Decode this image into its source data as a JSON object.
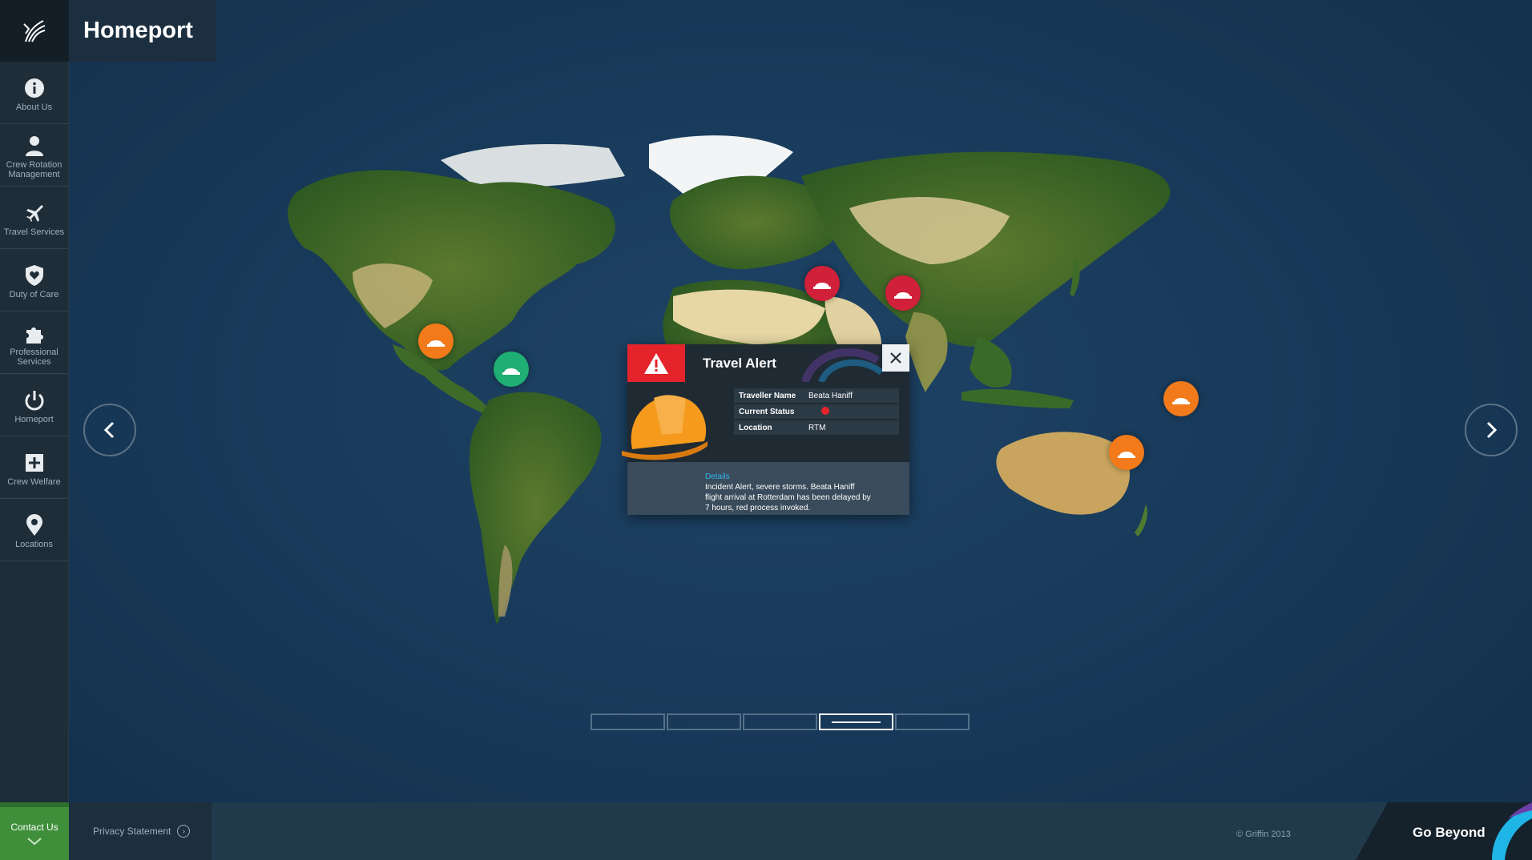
{
  "app": {
    "title": "Homeport"
  },
  "sidebar": {
    "items": [
      {
        "label": "About Us",
        "icon": "info-icon"
      },
      {
        "label": "Crew Rotation Management",
        "icon": "person-icon"
      },
      {
        "label": "Travel Services",
        "icon": "plane-icon"
      },
      {
        "label": "Duty of Care",
        "icon": "shield-heart-icon"
      },
      {
        "label": "Professional Services",
        "icon": "puzzle-icon"
      },
      {
        "label": "Homeport",
        "icon": "power-icon"
      },
      {
        "label": "Crew Welfare",
        "icon": "plus-icon"
      },
      {
        "label": "Locations",
        "icon": "pin-icon"
      }
    ],
    "contact_label": "Contact Us"
  },
  "markers": [
    {
      "region": "west-us",
      "status": "amber",
      "color": "#f27a1a"
    },
    {
      "region": "mexico",
      "status": "green",
      "color": "#1fae73"
    },
    {
      "region": "western-europe",
      "status": "red",
      "color": "#d0203a"
    },
    {
      "region": "eastern-europe",
      "status": "red",
      "color": "#d0203a"
    },
    {
      "region": "east-asia",
      "status": "amber",
      "color": "#f27a1a"
    },
    {
      "region": "southeast-asia",
      "status": "amber",
      "color": "#f27a1a"
    }
  ],
  "popup": {
    "title": "Travel Alert",
    "rows": [
      {
        "key": "Traveller Name",
        "value": "Beata Haniff"
      },
      {
        "key": "Current Status",
        "value": ""
      },
      {
        "key": "Location",
        "value": "RTM"
      }
    ],
    "status_color": "#e4242a",
    "details_label": "Details",
    "details_text": "Incident Alert, severe storms. Beata Haniff flight arrival at Rotterdam has been delayed by 7 hours, red process invoked."
  },
  "pager": {
    "count": 5,
    "active_index": 3
  },
  "footer": {
    "privacy": "Privacy Statement",
    "copyright": "© Griffin 2013",
    "tagline": "Go Beyond"
  },
  "colors": {
    "accent_green": "#3f8f3a",
    "alert_red": "#e4242a",
    "details_blue": "#33b5f0"
  }
}
